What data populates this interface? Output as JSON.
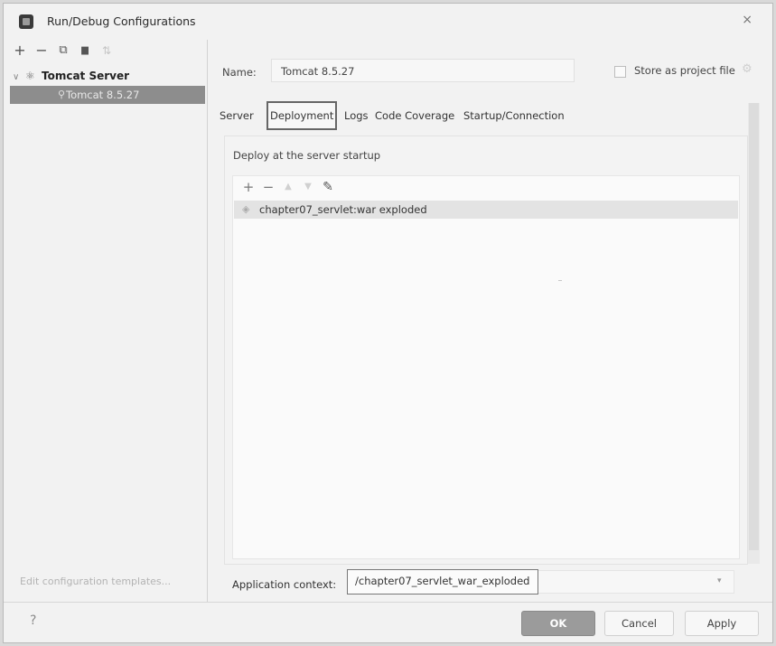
{
  "window": {
    "title": "Run/Debug Configurations",
    "close_glyph": "×"
  },
  "left_toolbar": {
    "add": "+",
    "remove": "−",
    "copy": "⧉",
    "folder": "▆",
    "sort": "⇅"
  },
  "tree": {
    "group_chevron": "∨",
    "group_icon": "tomcat-icon",
    "group_label": "Tomcat Server",
    "item_icon": "tomcat-run-icon",
    "item_label": "Tomcat 8.5.27"
  },
  "edit_templates": "Edit configuration templates...",
  "name": {
    "label": "Name:",
    "value": "Tomcat 8.5.27"
  },
  "store": {
    "label": "Store as project file",
    "checked": false
  },
  "tabs": [
    {
      "label": "Server",
      "active": false
    },
    {
      "label": "Deployment",
      "active": true
    },
    {
      "label": "Logs",
      "active": false
    },
    {
      "label": "Code Coverage",
      "active": false
    },
    {
      "label": "Startup/Connection",
      "active": false
    }
  ],
  "deploy": {
    "title": "Deploy at the server startup",
    "toolbar": {
      "add": "+",
      "remove": "−",
      "up": "▲",
      "down": "▼",
      "edit": "✎"
    },
    "items": [
      {
        "icon": "artifact-icon",
        "label": "chapter07_servlet:war exploded"
      }
    ]
  },
  "context": {
    "label": "Application context:",
    "value": "/chapter07_servlet_war_exploded",
    "dropdown": "▾"
  },
  "buttons": {
    "help": "?",
    "ok": "OK",
    "cancel": "Cancel",
    "apply": "Apply"
  },
  "colors": {
    "selection_bg": "#8d8d8d",
    "ok_bg": "#9b9b9b",
    "list_row_bg": "#e3e3e3"
  }
}
